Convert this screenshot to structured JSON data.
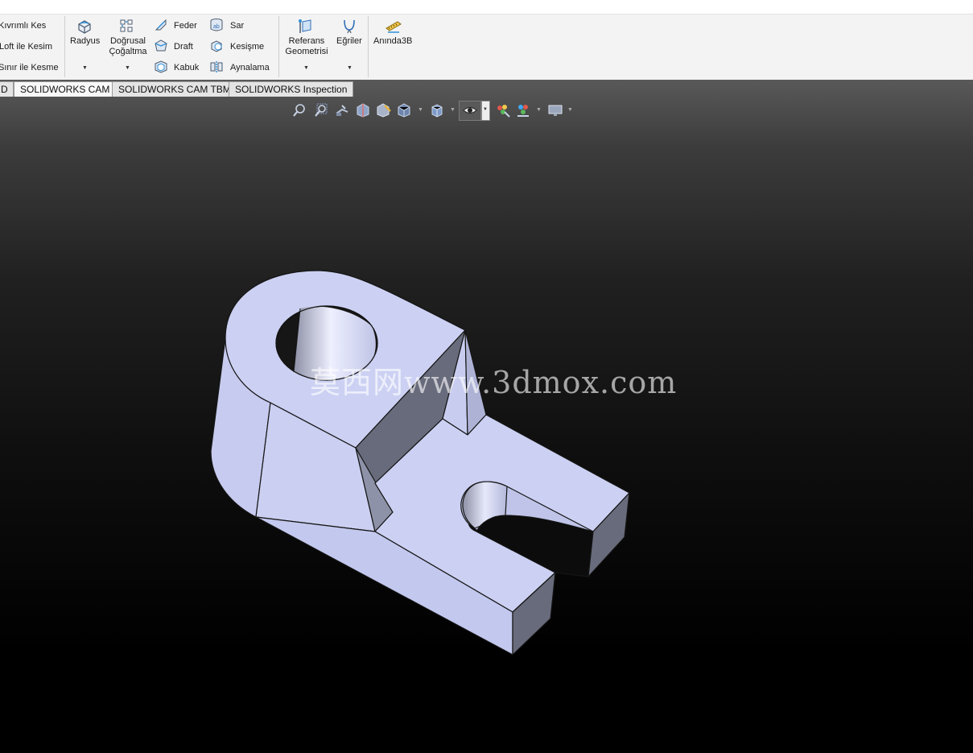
{
  "ribbon": {
    "cut_commands": [
      "Kıvrımlı Kes",
      "Loft ile Kesim",
      "Sınır ile Kesme"
    ],
    "radius_label": "Radyus",
    "linear_pattern_label": [
      "Doğrusal",
      "Çoğaltma"
    ],
    "features_col1": [
      "Feder",
      "Draft",
      "Kabuk"
    ],
    "features_col2": [
      "Sar",
      "Kesişme",
      "Aynalama"
    ],
    "reference_geometry_label": [
      "Referans",
      "Geometrisi"
    ],
    "curves_label": "Eğriler",
    "instant3d_label": "Anında3B"
  },
  "tabs": {
    "cut_tab": "D",
    "items": [
      "SOLIDWORKS CAM",
      "SOLIDWORKS CAM TBM",
      "SOLIDWORKS Inspection"
    ],
    "active_index": 0
  },
  "heads_up_toolbar": {
    "icons": [
      "zoom-to-fit-icon",
      "zoom-to-area-icon",
      "previous-view-icon",
      "section-view-icon",
      "dynamic-annotation-icon",
      "view-orientation-icon",
      "display-style-icon",
      "hide-show-items-icon",
      "edit-appearance-icon",
      "apply-scene-icon",
      "view-settings-icon"
    ]
  },
  "viewport": {
    "watermark": "莫西网www.3dmox.com",
    "model_color": "#ccd1f3",
    "model_shadow": "#6b6e80"
  }
}
